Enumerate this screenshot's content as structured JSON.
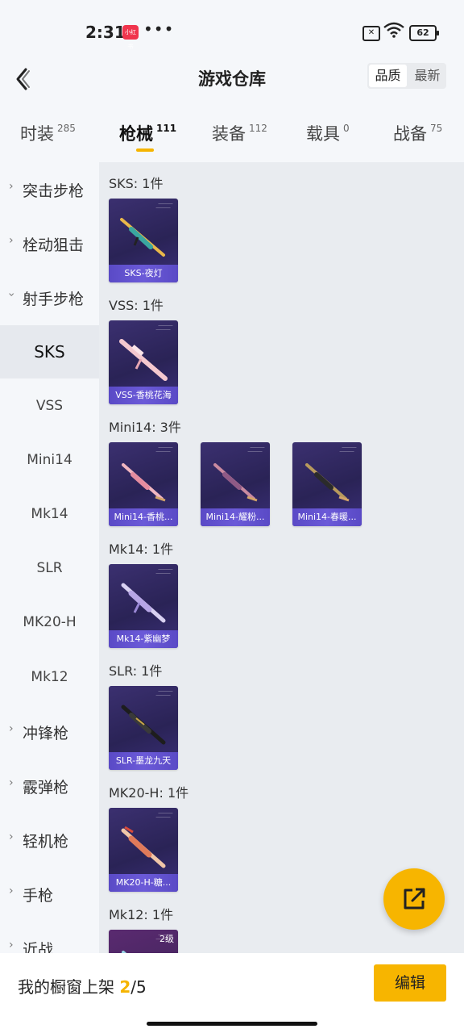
{
  "status_bar": {
    "time": "2:31",
    "app_badge": "小红书",
    "dots": "•••",
    "battery": "62"
  },
  "header": {
    "title": "游戏仓库",
    "sort_options": [
      "品质",
      "最新"
    ]
  },
  "tabs": [
    {
      "label": "时装",
      "count": "285"
    },
    {
      "label": "枪械",
      "count": "111"
    },
    {
      "label": "装备",
      "count": "112"
    },
    {
      "label": "载具",
      "count": "0"
    },
    {
      "label": "战备",
      "count": "75"
    }
  ],
  "sidebar": {
    "top_categories": [
      "突击步枪",
      "栓动狙击",
      "射手步枪"
    ],
    "sub_items": [
      "SKS",
      "VSS",
      "Mini14",
      "Mk14",
      "SLR",
      "MK20-H",
      "Mk12"
    ],
    "bottom_categories": [
      "冲锋枪",
      "霰弹枪",
      "轻机枪",
      "手枪",
      "近战"
    ]
  },
  "groups": [
    {
      "label": "SKS: 1件",
      "items": [
        {
          "name": "SKS-夜灯"
        }
      ]
    },
    {
      "label": "VSS: 1件",
      "items": [
        {
          "name": "VSS-香桃花海"
        }
      ]
    },
    {
      "label": "Mini14: 3件",
      "items": [
        {
          "name": "Mini14-香桃..."
        },
        {
          "name": "Mini14-耀粉..."
        },
        {
          "name": "Mini14-春暖..."
        }
      ]
    },
    {
      "label": "Mk14: 1件",
      "items": [
        {
          "name": "Mk14-紫幽梦"
        }
      ]
    },
    {
      "label": "SLR: 1件",
      "items": [
        {
          "name": "SLR-墨龙九天"
        }
      ]
    },
    {
      "label": "MK20-H: 1件",
      "items": [
        {
          "name": "MK20-H-糖..."
        }
      ]
    },
    {
      "label": "Mk12: 1件",
      "items": [
        {
          "name": "",
          "level": "2级"
        }
      ]
    }
  ],
  "bottom_bar": {
    "shelf_label": "我的橱窗上架",
    "shelf_current": "2",
    "shelf_total": "/5",
    "edit_label": "编辑"
  },
  "colors": {
    "accent": "#f7b500",
    "card_bg": "#2a2356",
    "card_label": "#5a4ac6"
  }
}
